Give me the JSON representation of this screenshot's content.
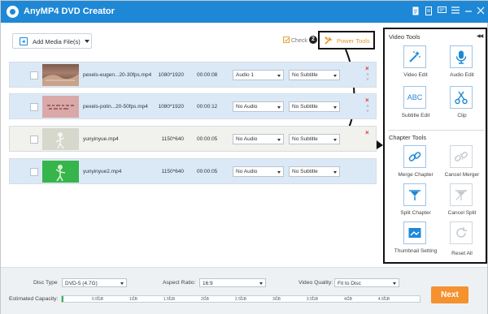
{
  "app": {
    "title": "AnyMP4 DVD Creator"
  },
  "titlebar": {
    "icons": [
      "document-icon",
      "document-alt-icon",
      "feedback-icon",
      "menu-icon",
      "minimize-icon",
      "close-icon"
    ]
  },
  "toolbar": {
    "add_media_label": "Add Media File(s)",
    "check_all_label": "Check",
    "callout_number": "2",
    "power_tools_label": "Power Tools"
  },
  "files": [
    {
      "name": "pexels-eugen...20-30fps.mp4",
      "resolution": "1080*1920",
      "duration": "00:00:08",
      "audio": "Audio 1",
      "subtitle": "No Subtitle",
      "thumb": "brown-landscape"
    },
    {
      "name": "pexels-polin...20-50fps.mp4",
      "resolution": "1080*1920",
      "duration": "00:00:12",
      "audio": "No Audio",
      "subtitle": "No Subtitle",
      "thumb": "pink-text"
    },
    {
      "name": "yunyinyue.mp4",
      "resolution": "1150*640",
      "duration": "00:00:05",
      "audio": "No Audio",
      "subtitle": "No Subtitle",
      "thumb": "white-figure"
    },
    {
      "name": "yunyinyue2.mp4",
      "resolution": "1150*640",
      "duration": "00:00:05",
      "audio": "No Audio",
      "subtitle": "No Subtitle",
      "thumb": "green-screen"
    }
  ],
  "row_controls": {
    "remove_glyph": "×",
    "up_glyph": "˄",
    "down_glyph": "˅"
  },
  "video_tools": {
    "title": "Video Tools",
    "items": [
      {
        "label": "Video Edit",
        "icon": "magic-wand-icon"
      },
      {
        "label": "Audio Edit",
        "icon": "microphone-icon"
      },
      {
        "label": "Subtitle Edit",
        "icon": "abc-icon",
        "icon_text": "ABC"
      },
      {
        "label": "Clip",
        "icon": "scissors-icon"
      }
    ]
  },
  "chapter_tools": {
    "title": "Chapter Tools",
    "items": [
      {
        "label": "Merge Chapter",
        "icon": "link-icon",
        "enabled": true
      },
      {
        "label": "Cancel Merger",
        "icon": "broken-link-icon",
        "enabled": false
      },
      {
        "label": "Split Chapter",
        "icon": "split-icon",
        "enabled": true
      },
      {
        "label": "Cancel Split",
        "icon": "cancel-split-icon",
        "enabled": false
      },
      {
        "label": "Thumbnail Setting",
        "icon": "thumbnail-icon",
        "enabled": true
      },
      {
        "label": "Reset All",
        "icon": "reset-icon",
        "enabled": false
      }
    ]
  },
  "bottom": {
    "disc_type_label": "Disc Type",
    "disc_type_value": "DVD-5 (4.7G)",
    "aspect_ratio_label": "Aspect Ratio:",
    "aspect_ratio_value": "16:9",
    "video_quality_label": "Video Quality:",
    "video_quality_value": "Fit to Disc",
    "capacity_label": "Estimated Capacity:",
    "capacity_fraction": 0.005,
    "capacity_ticks": [
      "0.5GB",
      "1GB",
      "1.5GB",
      "2GB",
      "2.5GB",
      "3GB",
      "3.5GB",
      "4GB",
      "4.5GB"
    ],
    "next_label": "Next"
  },
  "colors": {
    "titlebar": "#1e88d6",
    "accent_orange": "#f5922f",
    "row_selected": "#dbe9f7",
    "icon_blue": "#1e88d6",
    "capacity_green": "#3fb34f"
  }
}
